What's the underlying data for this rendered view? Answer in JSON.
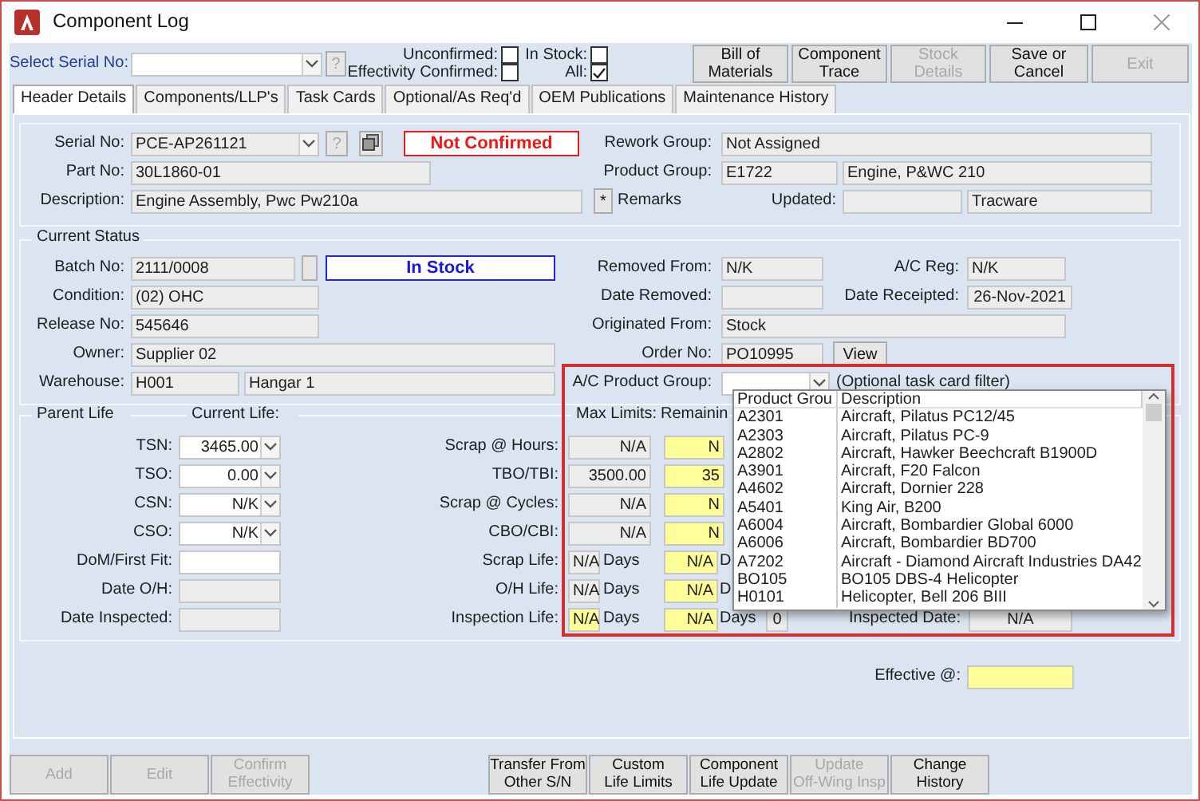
{
  "window": {
    "title": "Component Log"
  },
  "toolbar": {
    "serial_label": "Select Serial No:",
    "help_button": "?",
    "filters": [
      {
        "label": "Unconfirmed:",
        "checked": false
      },
      {
        "label": "In Stock:",
        "checked": false
      },
      {
        "label": "Effectivity Confirmed:",
        "checked": false
      },
      {
        "label": "All:",
        "checked": true
      }
    ],
    "buttons": [
      {
        "label": "Bill of\nMaterials",
        "disabled": false
      },
      {
        "label": "Component\nTrace",
        "disabled": false
      },
      {
        "label": "Stock\nDetails",
        "disabled": true
      },
      {
        "label": "Save or\nCancel",
        "disabled": false
      },
      {
        "label": "Exit",
        "disabled": true
      }
    ]
  },
  "tabs": [
    {
      "label": "Header Details",
      "selected": true
    },
    {
      "label": "Components/LLP's",
      "selected": false
    },
    {
      "label": "Task Cards",
      "selected": false
    },
    {
      "label": "Optional/As Req'd",
      "selected": false
    },
    {
      "label": "OEM Publications",
      "selected": false
    },
    {
      "label": "Maintenance History",
      "selected": false
    }
  ],
  "header": {
    "serial_no": {
      "label": "Serial No:",
      "value": "PCE-AP261121"
    },
    "help_button": "?",
    "status": "Not Confirmed",
    "rework_group": {
      "label": "Rework Group:",
      "value": "Not Assigned"
    },
    "part_no": {
      "label": "Part No:",
      "value": "30L1860-01"
    },
    "product_group": {
      "label": "Product Group:",
      "code": "E1722",
      "name": "Engine, P&WC 210"
    },
    "description": {
      "label": "Description:",
      "value": "Engine Assembly, Pwc Pw210a"
    },
    "remarks_button": "*",
    "remarks_label": "Remarks",
    "updated": {
      "label": "Updated:",
      "user": "Tracware"
    }
  },
  "current_status": {
    "title": "Current Status",
    "batch_no": {
      "label": "Batch No:",
      "value": "2111/0008"
    },
    "stock_status": "In Stock",
    "removed_from": {
      "label": "Removed From:",
      "value": "N/K"
    },
    "ac_reg": {
      "label": "A/C Reg:",
      "value": "N/K"
    },
    "condition": {
      "label": "Condition:",
      "value": "(02) OHC"
    },
    "date_removed": {
      "label": "Date Removed:"
    },
    "date_receipted": {
      "label": "Date Receipted:",
      "value": "26-Nov-2021"
    },
    "release_no": {
      "label": "Release No:",
      "value": "545646"
    },
    "originated_from": {
      "label": "Originated From:",
      "value": "Stock"
    },
    "owner": {
      "label": "Owner:",
      "value": "Supplier 02"
    },
    "order_no": {
      "label": "Order No:",
      "value": "PO10995",
      "button": "View"
    },
    "warehouse": {
      "label": "Warehouse:",
      "code": "H001",
      "name": "Hangar 1"
    },
    "ac_product_group": {
      "label": "A/C Product Group:",
      "hint": "(Optional task card filter)"
    }
  },
  "parent_life": {
    "title": "Parent Life",
    "current_life_title": "Current Life:",
    "max_limits_title": "Max Limits:",
    "remaining_title": "Remainin",
    "current": [
      {
        "label": "TSN:",
        "value": "3465.00",
        "kind": "combo"
      },
      {
        "label": "TSO:",
        "value": "0.00",
        "kind": "combo"
      },
      {
        "label": "CSN:",
        "value": "N/K",
        "kind": "combo"
      },
      {
        "label": "CSO:",
        "value": "N/K",
        "kind": "combo"
      },
      {
        "label": "DoM/First Fit:",
        "kind": "input"
      },
      {
        "label": "Date O/H:",
        "kind": "readonly"
      },
      {
        "label": "Date Inspected:",
        "kind": "readonly"
      }
    ],
    "limits": [
      {
        "label": "Scrap @ Hours:",
        "kind": "hours",
        "max": "N/A",
        "highlighted": false,
        "remaining": "N"
      },
      {
        "label": "TBO/TBI:",
        "kind": "hours",
        "max": "3500.00",
        "highlighted": false,
        "remaining": "35"
      },
      {
        "label": "Scrap @ Cycles:",
        "kind": "hours",
        "max": "N/A",
        "highlighted": false,
        "remaining": "N"
      },
      {
        "label": "CBO/CBI:",
        "kind": "hours",
        "max": "N/A",
        "highlighted": false,
        "remaining": "N"
      },
      {
        "label": "Scrap Life:",
        "kind": "days",
        "max": "N/A",
        "max_unit": "Days",
        "highlighted": false,
        "remaining": "N/A",
        "remaining_unit": "D"
      },
      {
        "label": "O/H Life:",
        "kind": "days",
        "max": "N/A",
        "max_unit": "Days",
        "highlighted": false,
        "remaining": "N/A",
        "remaining_unit": "D"
      },
      {
        "label": "Inspection Life:",
        "kind": "days",
        "max": "N/A",
        "max_unit": "Days",
        "highlighted": true,
        "remaining": "N/A",
        "remaining_unit": "Days"
      }
    ],
    "inspection": {
      "count": "0",
      "date_label": "Inspected Date:",
      "date": "N/A"
    }
  },
  "effective": {
    "label": "Effective @:"
  },
  "footer_buttons": [
    {
      "label": "Add",
      "disabled": true
    },
    {
      "label": "Edit",
      "disabled": true
    },
    {
      "label": "Confirm\nEffectivity",
      "disabled": true
    },
    {
      "label": "Transfer From\nOther S/N",
      "disabled": false
    },
    {
      "label": "Custom\nLife Limits",
      "disabled": false
    },
    {
      "label": "Component\nLife Update",
      "disabled": false
    },
    {
      "label": "Update\nOff-Wing Insp",
      "disabled": true
    },
    {
      "label": "Change\nHistory",
      "disabled": false
    }
  ],
  "dropdown": {
    "columns": [
      "Product Grou",
      "Description"
    ],
    "rows": [
      {
        "code": "A2301",
        "description": "Aircraft, Pilatus PC12/45"
      },
      {
        "code": "A2303",
        "description": "Aircraft, Pilatus PC-9"
      },
      {
        "code": "A2802",
        "description": "Aircraft, Hawker Beechcraft B1900D"
      },
      {
        "code": "A3901",
        "description": "Aircraft, F20 Falcon"
      },
      {
        "code": "A4602",
        "description": "Aircraft, Dornier 228"
      },
      {
        "code": "A5401",
        "description": "King Air, B200"
      },
      {
        "code": "A6004",
        "description": "Aircraft, Bombardier Global 6000"
      },
      {
        "code": "A6006",
        "description": "Aircraft, Bombardier BD700"
      },
      {
        "code": "A7202",
        "description": "Aircraft - Diamond Aircraft Industries DA42"
      },
      {
        "code": "BO105",
        "description": "BO105 DBS-4 Helicopter"
      },
      {
        "code": "H0101",
        "description": "Helicopter, Bell 206 BIII"
      }
    ]
  }
}
